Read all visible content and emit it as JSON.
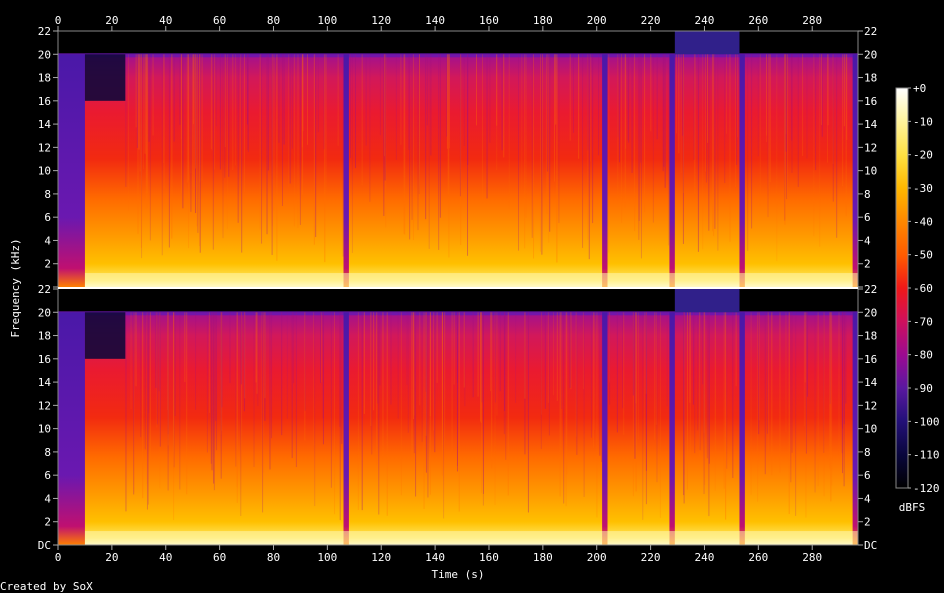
{
  "footer": {
    "created_by": "Created by SoX"
  },
  "chart_data": {
    "type": "heatmap",
    "subtype": "spectrogram",
    "channels": 2,
    "xlabel": "Time (s)",
    "ylabel": "Frequency (kHz)",
    "xlim": [
      0,
      297
    ],
    "x_ticks": [
      0,
      20,
      40,
      60,
      80,
      100,
      120,
      140,
      160,
      180,
      200,
      220,
      240,
      260,
      280
    ],
    "x_tick_labels": [
      "0",
      "20",
      "40",
      "60",
      "80",
      "100",
      "120",
      "140",
      "160",
      "180",
      "200",
      "220",
      "240",
      "260",
      "280"
    ],
    "ylim_khz": [
      0,
      22
    ],
    "y_ticks": [
      0,
      2,
      4,
      6,
      8,
      10,
      12,
      14,
      16,
      18,
      20,
      22
    ],
    "y_tick_labels": [
      "DC",
      "2",
      "4",
      "6",
      "8",
      "10",
      "12",
      "14",
      "16",
      "18",
      "20",
      "22"
    ],
    "colorbar": {
      "label": "dBFS",
      "range": [
        -120,
        0
      ],
      "ticks": [
        0,
        -10,
        -20,
        -30,
        -40,
        -50,
        -60,
        -70,
        -80,
        -90,
        -100,
        -110,
        -120
      ],
      "tick_labels": [
        "+0",
        "-10",
        "-20",
        "-30",
        "-40",
        "-50",
        "-60",
        "-70",
        "-80",
        "-90",
        "-100",
        "-110",
        "-120"
      ],
      "colors": [
        "#ffffff",
        "#fff4a0",
        "#ffe040",
        "#ffb800",
        "#ff8a00",
        "#ff5a00",
        "#f01818",
        "#d0105a",
        "#9a0a92",
        "#5a18a0",
        "#24107a",
        "#08063a",
        "#000000"
      ]
    },
    "quiet_segments_s": [
      {
        "start": 0,
        "end": 10,
        "level": "quiet intro"
      },
      {
        "start": 106,
        "end": 108,
        "level": "gap"
      },
      {
        "start": 202,
        "end": 204,
        "level": "gap"
      },
      {
        "start": 227,
        "end": 229,
        "level": "gap"
      },
      {
        "start": 253,
        "end": 255,
        "level": "gap"
      },
      {
        "start": 295,
        "end": 297,
        "level": "fade"
      }
    ]
  }
}
